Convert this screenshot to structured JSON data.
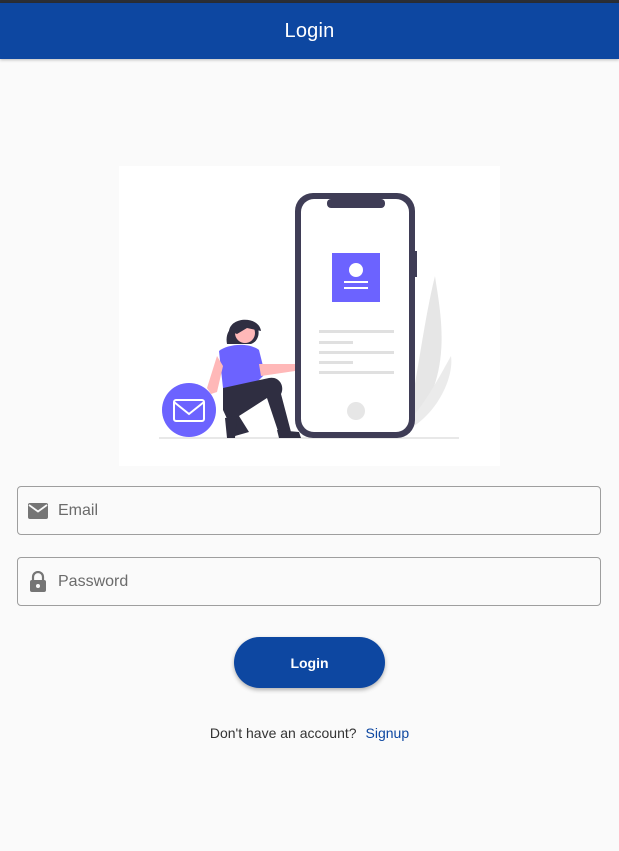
{
  "appbar": {
    "title": "Login",
    "color": "#0d47a1"
  },
  "illustration": {
    "name": "mobile login illustration with woman, phone and envelope"
  },
  "form": {
    "email": {
      "placeholder": "Email",
      "value": "",
      "icon": "mail-icon"
    },
    "password": {
      "placeholder": "Password",
      "value": "",
      "icon": "lock-icon"
    },
    "login_label": "Login"
  },
  "signup": {
    "prompt": "Don't have an account?",
    "link": "Signup"
  },
  "colors": {
    "accent": "#0d47a1",
    "illustration_purple": "#6c63ff"
  }
}
